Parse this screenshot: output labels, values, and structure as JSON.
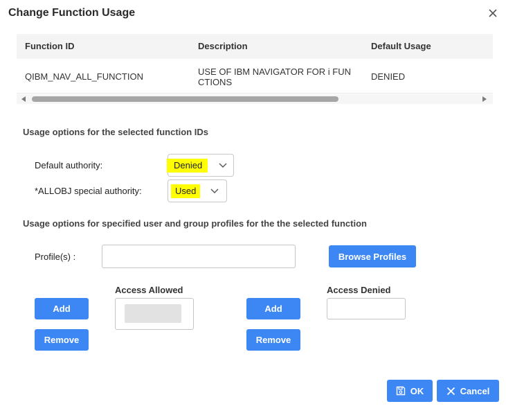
{
  "dialog": {
    "title": "Change Function Usage"
  },
  "table": {
    "headers": [
      "Function ID",
      "Description",
      "Default Usage"
    ],
    "row": {
      "function_id": "QIBM_NAV_ALL_FUNCTION",
      "description_line1": "USE OF IBM NAVIGATOR FOR i FUN",
      "description_line2": "CTIONS",
      "default_usage": "DENIED"
    }
  },
  "usage_options": {
    "heading": "Usage options for the selected function IDs",
    "default_authority_label": "Default authority:",
    "default_authority_value": "Denied",
    "allobj_label": "*ALLOBJ special authority:",
    "allobj_value": "Used"
  },
  "profiles": {
    "heading": "Usage options for specified user and group profiles for the the selected function",
    "profile_label": "Profile(s) :",
    "profile_value": "",
    "browse_label": "Browse Profiles",
    "access_allowed_label": "Access Allowed",
    "access_denied_label": "Access Denied",
    "add_label": "Add",
    "remove_label": "Remove"
  },
  "footer": {
    "ok_label": "OK",
    "cancel_label": "Cancel"
  },
  "colors": {
    "accent": "#3d87f5",
    "highlight": "#ffff00"
  }
}
